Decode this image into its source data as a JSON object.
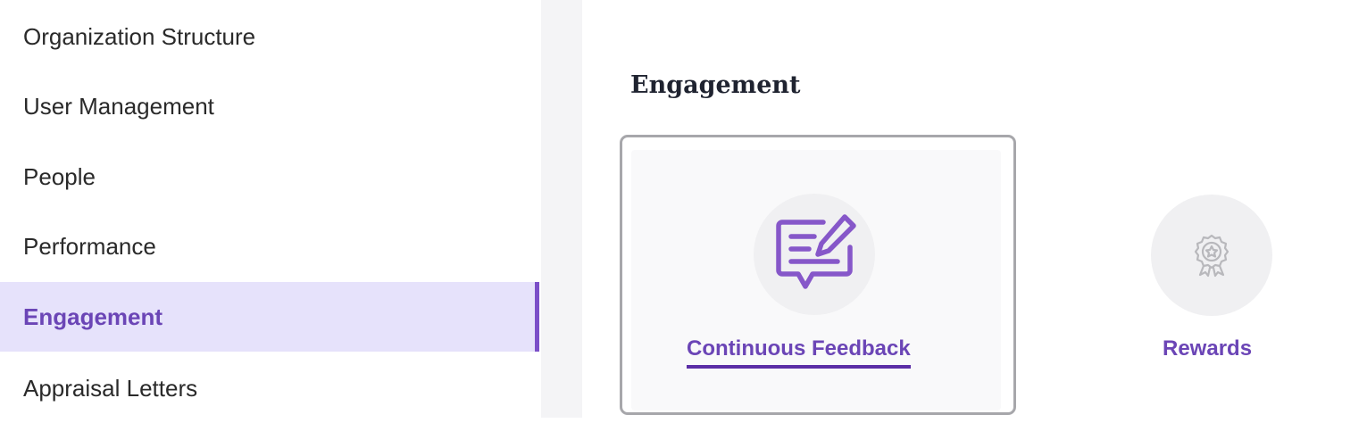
{
  "sidebar": {
    "items": [
      {
        "label": "Organization Structure"
      },
      {
        "label": "User Management"
      },
      {
        "label": "People"
      },
      {
        "label": "Performance"
      },
      {
        "label": "Engagement"
      },
      {
        "label": "Appraisal Letters"
      }
    ],
    "active_item": "Engagement"
  },
  "main": {
    "section_title": "Engagement",
    "cards": [
      {
        "label": "Continuous Feedback",
        "icon": "feedback-icon",
        "selected": true
      },
      {
        "label": "Rewards",
        "icon": "award-ribbon-icon",
        "selected": false
      }
    ]
  },
  "colors": {
    "accent": "#6b45b6",
    "accent_dark": "#5b2ea6",
    "active_bg": "#e6e2fb",
    "active_bar": "#7b4fc8",
    "icon_circle": "#f0f0f2",
    "selected_border": "#a7a7ab"
  }
}
